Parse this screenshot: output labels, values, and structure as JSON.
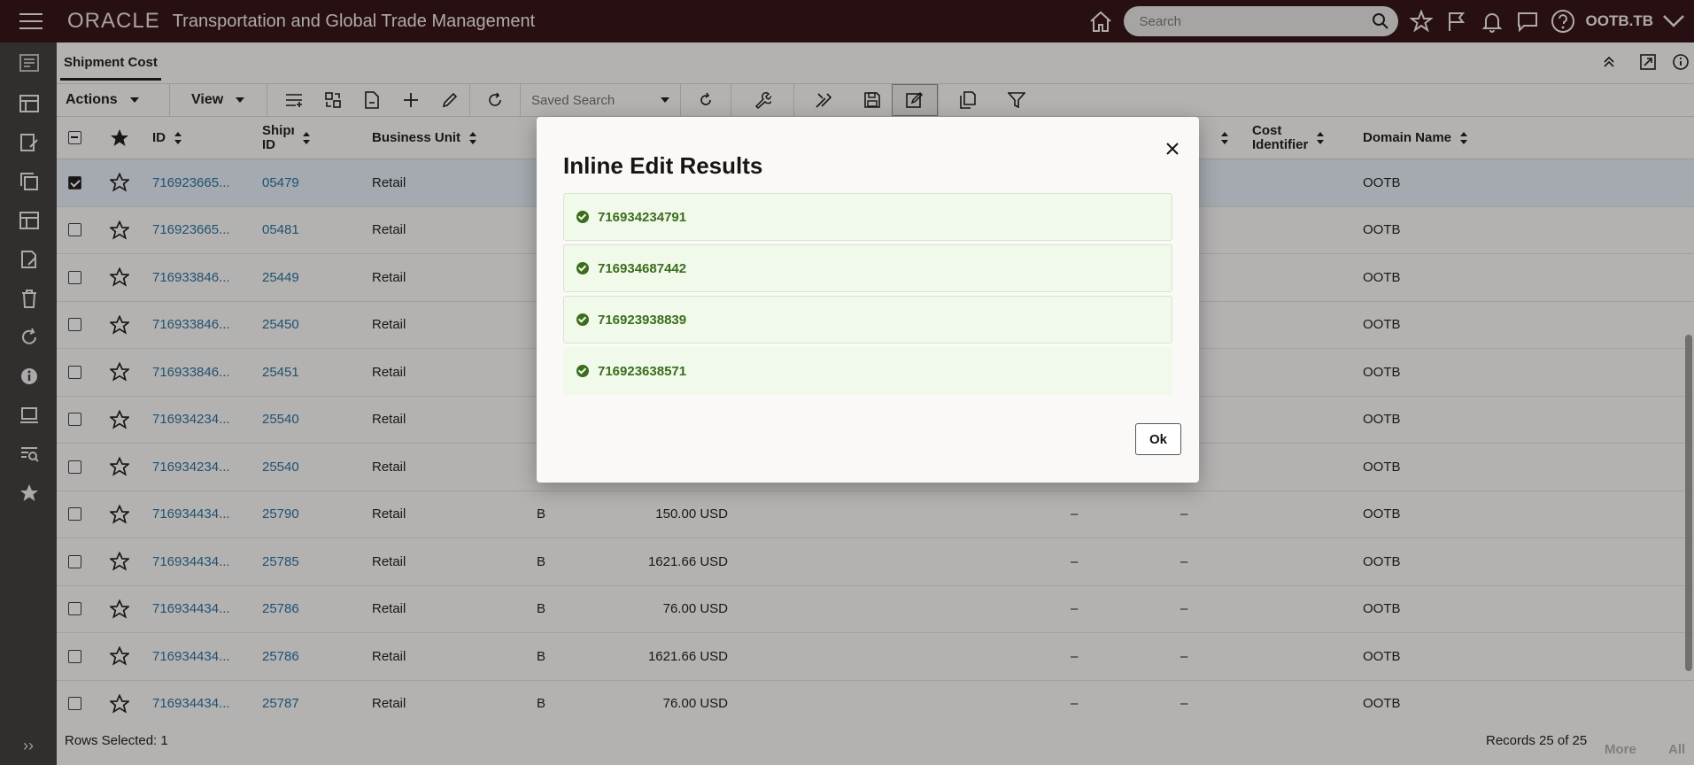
{
  "header": {
    "brand": "ORACLE",
    "product": "Transportation and Global Trade Management",
    "search_placeholder": "Search",
    "user": "OOTB.TB"
  },
  "page": {
    "tab": "Shipment Cost"
  },
  "toolbar": {
    "actions": "Actions",
    "view": "View",
    "saved_search": "Saved Search"
  },
  "table": {
    "columns": {
      "id": "ID",
      "shipment_id": "Shipment ID",
      "business_unit": "Business Unit",
      "cost_identifier": "Cost Identifier",
      "domain_name": "Domain Name"
    },
    "rows": [
      {
        "id": "716923665...",
        "shipment": "05479",
        "bu": "Retail",
        "type": "",
        "cost": "",
        "c1": "",
        "c2": "",
        "domain": "OOTB"
      },
      {
        "id": "716923665...",
        "shipment": "05481",
        "bu": "Retail",
        "type": "",
        "cost": "",
        "c1": "",
        "c2": "",
        "domain": "OOTB"
      },
      {
        "id": "716933846...",
        "shipment": "25449",
        "bu": "Retail",
        "type": "",
        "cost": "",
        "c1": "",
        "c2": "",
        "domain": "OOTB"
      },
      {
        "id": "716933846...",
        "shipment": "25450",
        "bu": "Retail",
        "type": "",
        "cost": "",
        "c1": "",
        "c2": "",
        "domain": "OOTB"
      },
      {
        "id": "716933846...",
        "shipment": "25451",
        "bu": "Retail",
        "type": "",
        "cost": "",
        "c1": "",
        "c2": "",
        "domain": "OOTB"
      },
      {
        "id": "716934234...",
        "shipment": "25540",
        "bu": "Retail",
        "type": "",
        "cost": "",
        "c1": "",
        "c2": "",
        "domain": "OOTB"
      },
      {
        "id": "716934234...",
        "shipment": "25540",
        "bu": "Retail",
        "type": "",
        "cost": "",
        "c1": "",
        "c2": "",
        "domain": "OOTB"
      },
      {
        "id": "716934434...",
        "shipment": "25790",
        "bu": "Retail",
        "type": "B",
        "cost": "150.00 USD",
        "c1": "–",
        "c2": "–",
        "domain": "OOTB"
      },
      {
        "id": "716934434...",
        "shipment": "25785",
        "bu": "Retail",
        "type": "B",
        "cost": "1621.66 USD",
        "c1": "–",
        "c2": "–",
        "domain": "OOTB"
      },
      {
        "id": "716934434...",
        "shipment": "25786",
        "bu": "Retail",
        "type": "B",
        "cost": "76.00 USD",
        "c1": "–",
        "c2": "–",
        "domain": "OOTB"
      },
      {
        "id": "716934434...",
        "shipment": "25786",
        "bu": "Retail",
        "type": "B",
        "cost": "1621.66 USD",
        "c1": "–",
        "c2": "–",
        "domain": "OOTB"
      },
      {
        "id": "716934434...",
        "shipment": "25787",
        "bu": "Retail",
        "type": "B",
        "cost": "76.00 USD",
        "c1": "–",
        "c2": "–",
        "domain": "OOTB"
      }
    ]
  },
  "footer": {
    "rows_selected": "Rows Selected: 1",
    "records": "Records 25 of 25",
    "more": "More",
    "all": "All"
  },
  "dialog": {
    "title": "Inline Edit Results",
    "results": [
      "716934234791",
      "716934687442",
      "716923938839",
      "716923638571"
    ],
    "ok_label": "Ok"
  },
  "colors": {
    "header_bg": "#2d0a0d",
    "rail_bg": "#3a3735",
    "link": "#1f6b9a",
    "success_text": "#3b6d1c",
    "success_bg": "#f1f9ea",
    "selected_row": "#e4eef6"
  }
}
